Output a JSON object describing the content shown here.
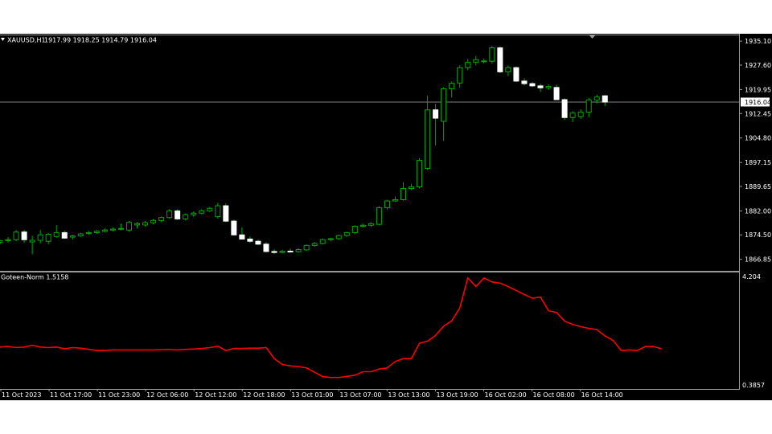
{
  "chart_data": [
    {
      "type": "candlestick",
      "symbol_label": "XAUUSD,H1",
      "ohlc_readout": "1917.99 1918.25 1914.79 1916.04",
      "y_ticks": [
        "1935.10",
        "1927.60",
        "1919.95",
        "1912.45",
        "1904.80",
        "1897.15",
        "1889.65",
        "1882.00",
        "1874.50",
        "1866.85"
      ],
      "ylim": [
        1863.5,
        1936.9
      ],
      "current_price_label": "1916.04",
      "current_price": 1916.04,
      "colors": {
        "bull": "#00aa00",
        "bear_fill": "#ffffff",
        "price_line": "#808080",
        "background": "#000000"
      },
      "candles": [
        [
          1872.2,
          1872.9,
          1871.5,
          1872.7
        ],
        [
          1872.7,
          1873.8,
          1872.1,
          1873.0
        ],
        [
          1873.0,
          1876.0,
          1872.5,
          1875.4
        ],
        [
          1875.4,
          1876.1,
          1872.0,
          1873.0
        ],
        [
          1872.3,
          1874.2,
          1868.4,
          1872.8
        ],
        [
          1872.8,
          1876.0,
          1871.8,
          1874.5
        ],
        [
          1872.5,
          1875.1,
          1871.6,
          1874.7
        ],
        [
          1874.0,
          1877.5,
          1873.6,
          1875.2
        ],
        [
          1875.2,
          1875.8,
          1873.3,
          1873.5
        ],
        [
          1873.8,
          1874.5,
          1873.0,
          1874.2
        ],
        [
          1874.2,
          1875.1,
          1873.9,
          1874.8
        ],
        [
          1874.9,
          1875.7,
          1874.5,
          1875.2
        ],
        [
          1875.2,
          1876.0,
          1874.8,
          1875.6
        ],
        [
          1875.6,
          1876.5,
          1875.3,
          1876.0
        ],
        [
          1876.0,
          1876.8,
          1875.6,
          1876.3
        ],
        [
          1876.3,
          1878.0,
          1875.9,
          1876.5
        ],
        [
          1876.0,
          1878.8,
          1875.5,
          1878.4
        ],
        [
          1877.6,
          1878.5,
          1876.5,
          1878.0
        ],
        [
          1877.6,
          1878.8,
          1877.1,
          1878.3
        ],
        [
          1878.3,
          1879.5,
          1877.8,
          1879.0
        ],
        [
          1879.0,
          1880.2,
          1878.5,
          1879.9
        ],
        [
          1879.9,
          1882.5,
          1879.6,
          1882.0
        ],
        [
          1882.0,
          1882.5,
          1879.2,
          1879.5
        ],
        [
          1879.5,
          1881.2,
          1879.0,
          1880.8
        ],
        [
          1880.8,
          1881.8,
          1880.2,
          1881.3
        ],
        [
          1881.3,
          1882.5,
          1880.9,
          1882.0
        ],
        [
          1882.0,
          1883.2,
          1881.7,
          1882.8
        ],
        [
          1880.2,
          1884.5,
          1879.6,
          1883.6
        ],
        [
          1883.6,
          1884.3,
          1878.5,
          1878.8
        ],
        [
          1878.8,
          1879.3,
          1874.3,
          1874.5
        ],
        [
          1874.5,
          1876.8,
          1873.0,
          1873.2
        ],
        [
          1873.2,
          1874.0,
          1872.0,
          1872.5
        ],
        [
          1872.5,
          1873.0,
          1871.3,
          1871.6
        ],
        [
          1871.6,
          1872.2,
          1869.0,
          1869.3
        ],
        [
          1869.3,
          1870.0,
          1868.5,
          1869.0
        ],
        [
          1869.0,
          1869.8,
          1868.7,
          1869.4
        ],
        [
          1869.4,
          1870.2,
          1869.0,
          1869.2
        ],
        [
          1869.2,
          1870.3,
          1868.9,
          1869.9
        ],
        [
          1869.8,
          1871.5,
          1869.5,
          1871.2
        ],
        [
          1871.2,
          1872.3,
          1870.8,
          1871.8
        ],
        [
          1871.8,
          1873.4,
          1871.5,
          1873.0
        ],
        [
          1873.0,
          1873.6,
          1872.5,
          1873.3
        ],
        [
          1873.3,
          1874.6,
          1872.9,
          1874.3
        ],
        [
          1874.3,
          1875.5,
          1873.9,
          1875.2
        ],
        [
          1875.2,
          1877.5,
          1874.7,
          1877.2
        ],
        [
          1877.2,
          1878.0,
          1876.8,
          1877.5
        ],
        [
          1877.5,
          1878.5,
          1877.0,
          1878.0
        ],
        [
          1877.8,
          1883.5,
          1877.5,
          1883.0
        ],
        [
          1883.0,
          1885.5,
          1882.4,
          1885.1
        ],
        [
          1885.1,
          1886.5,
          1884.8,
          1885.5
        ],
        [
          1885.5,
          1891.0,
          1885.2,
          1889.0
        ],
        [
          1889.0,
          1890.5,
          1888.5,
          1889.5
        ],
        [
          1889.5,
          1898.5,
          1889.0,
          1897.8
        ],
        [
          1895.3,
          1918.0,
          1894.8,
          1913.6
        ],
        [
          1913.6,
          1915.5,
          1902.5,
          1911.0
        ],
        [
          1910.0,
          1920.7,
          1903.9,
          1920.2
        ],
        [
          1920.2,
          1922.5,
          1917.5,
          1921.9
        ],
        [
          1922.0,
          1927.5,
          1920.5,
          1926.8
        ],
        [
          1926.8,
          1929.5,
          1926.0,
          1928.5
        ],
        [
          1928.5,
          1930.5,
          1927.5,
          1929.3
        ],
        [
          1928.7,
          1929.6,
          1928.1,
          1928.9
        ],
        [
          1928.8,
          1933.6,
          1928.1,
          1933.0
        ],
        [
          1933.0,
          1933.5,
          1925.1,
          1925.5
        ],
        [
          1925.5,
          1927.5,
          1924.2,
          1926.8
        ],
        [
          1926.8,
          1927.2,
          1922.3,
          1922.6
        ],
        [
          1922.6,
          1923.5,
          1921.2,
          1921.8
        ],
        [
          1921.8,
          1922.3,
          1920.8,
          1921.1
        ],
        [
          1921.1,
          1921.8,
          1919.2,
          1920.5
        ],
        [
          1920.5,
          1921.5,
          1919.8,
          1920.9
        ],
        [
          1920.6,
          1921.5,
          1916.8,
          1916.8
        ],
        [
          1916.8,
          1917.2,
          1910.5,
          1911.2
        ],
        [
          1911.2,
          1913.2,
          1909.8,
          1912.6
        ],
        [
          1911.5,
          1913.8,
          1910.8,
          1912.9
        ],
        [
          1912.9,
          1917.3,
          1911.3,
          1916.7
        ],
        [
          1916.7,
          1918.3,
          1915.6,
          1917.6
        ],
        [
          1917.99,
          1918.25,
          1914.79,
          1916.04
        ]
      ]
    },
    {
      "type": "line",
      "indicator_label": "Goteen-Norm 1.5158",
      "y_ticks": [
        "4.204",
        "0.3857"
      ],
      "ylim": [
        0.3857,
        4.204
      ],
      "x_labels": [
        "11 Oct 2023",
        "11 Oct 17:00",
        "11 Oct 23:00",
        "12 Oct 06:00",
        "12 Oct 12:00",
        "12 Oct 18:00",
        "13 Oct 01:00",
        "13 Oct 07:00",
        "13 Oct 13:00",
        "13 Oct 19:00",
        "16 Oct 02:00",
        "16 Oct 08:00",
        "16 Oct 14:00"
      ],
      "color": "#ff0000",
      "values": [
        1.72,
        1.74,
        1.7,
        1.72,
        1.78,
        1.72,
        1.7,
        1.72,
        1.66,
        1.7,
        1.68,
        1.64,
        1.6,
        1.6,
        1.62,
        1.62,
        1.62,
        1.62,
        1.62,
        1.62,
        1.63,
        1.63,
        1.62,
        1.64,
        1.65,
        1.67,
        1.7,
        1.75,
        1.6,
        1.67,
        1.67,
        1.68,
        1.68,
        1.7,
        1.32,
        1.12,
        1.07,
        1.05,
        1.0,
        0.85,
        0.7,
        0.67,
        0.67,
        0.71,
        0.75,
        0.87,
        0.87,
        0.96,
        1.0,
        1.22,
        1.32,
        1.32,
        1.85,
        1.92,
        2.12,
        2.44,
        2.62,
        3.06,
        4.1,
        3.8,
        4.1,
        3.96,
        3.92,
        3.8,
        3.67,
        3.53,
        3.4,
        3.44,
        2.97,
        2.91,
        2.61,
        2.5,
        2.42,
        2.36,
        2.32,
        2.1,
        1.95,
        1.6,
        1.62,
        1.6,
        1.74,
        1.74,
        1.66
      ]
    }
  ]
}
